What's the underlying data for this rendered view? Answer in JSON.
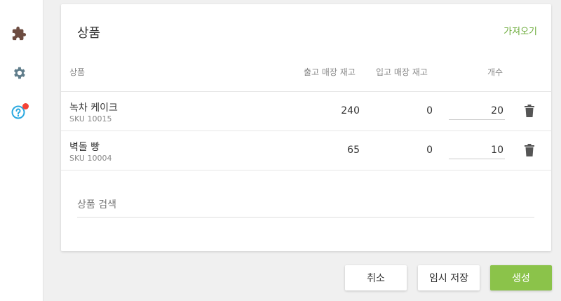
{
  "sidebar": {
    "icons": [
      "puzzle-icon",
      "gear-icon",
      "help-icon"
    ],
    "colors": {
      "puzzle": "#6d4c41",
      "gear": "#607d8b",
      "help": "#29a8e0",
      "badge": "#f44336"
    }
  },
  "card": {
    "title": "상품",
    "import_label": "가져오기"
  },
  "table": {
    "headers": {
      "product": "상품",
      "out_stock": "출고 매장 재고",
      "in_stock": "입고 매장 재고",
      "quantity": "개수"
    },
    "rows": [
      {
        "name": "녹차 케이크",
        "sku": "SKU 10015",
        "out_stock": "240",
        "in_stock": "0",
        "quantity": "20"
      },
      {
        "name": "벽돌 빵",
        "sku": "SKU 10004",
        "out_stock": "65",
        "in_stock": "0",
        "quantity": "10"
      }
    ]
  },
  "search": {
    "placeholder": "상품 검색"
  },
  "buttons": {
    "cancel": "취소",
    "save_draft": "임시 저장",
    "create": "생성"
  },
  "colors": {
    "accent": "#8bc34a",
    "link": "#6cab3a"
  }
}
